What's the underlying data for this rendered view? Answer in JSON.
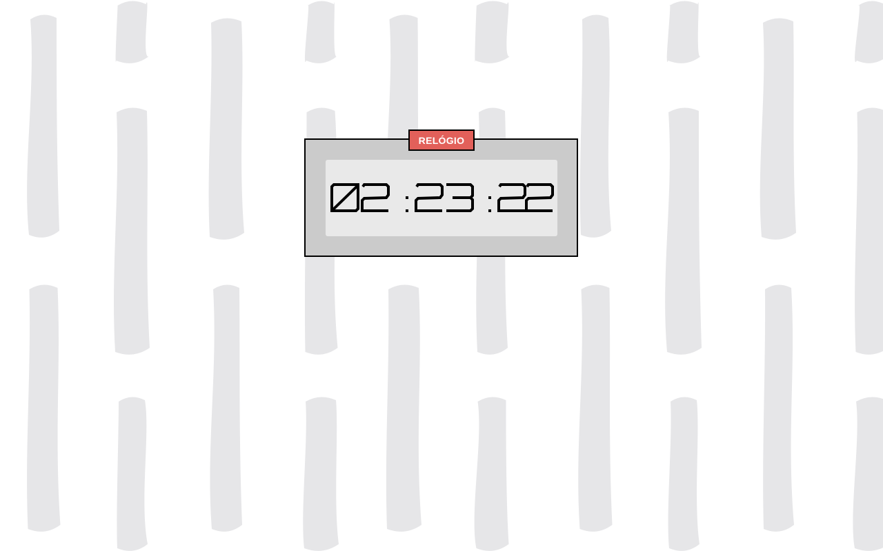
{
  "clock": {
    "badge_label": "RELÓGIO",
    "time": "02:23:22",
    "hours": "02",
    "minutes": "23",
    "seconds": "22"
  },
  "colors": {
    "page_background": "#ffffff",
    "pattern_strokes": "#e6e6e8",
    "card_background": "#cbcbcb",
    "display_background": "#e9e9e9",
    "badge_background": "#e2605a",
    "digit_color": "#000000"
  }
}
